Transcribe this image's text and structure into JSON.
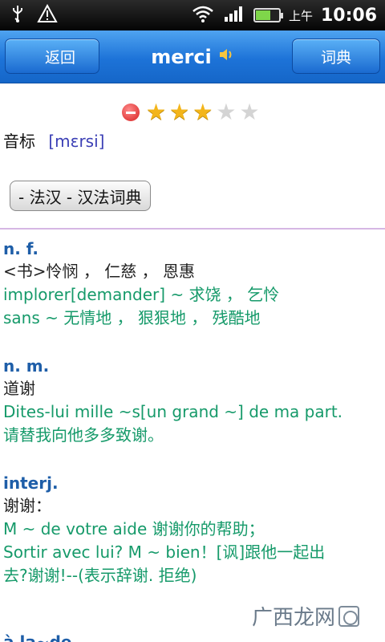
{
  "status_bar": {
    "icons": [
      "usb-icon",
      "warning-icon",
      "wifi-icon",
      "signal-icon",
      "battery-icon"
    ],
    "ampm": "上午",
    "time": "10:06"
  },
  "title_bar": {
    "back_label": "返回",
    "title": "merci",
    "dict_label": "词典",
    "accent": "#1d73d8"
  },
  "rating": {
    "value": 3,
    "max": 5
  },
  "phonetic": {
    "label": "音标",
    "ipa": "[mɛrsi]"
  },
  "dict_button": "- 法汉 - 汉法词典",
  "entries": [
    {
      "pos": "n. f.",
      "lines": [
        {
          "type": "zh",
          "text": "<书>怜悯 ， 仁慈 ， 恩惠"
        },
        {
          "type": "ex",
          "text": "implorer[demander] ~ 求饶 ， 乞怜"
        },
        {
          "type": "ex",
          "text": "sans ~ 无情地 ， 狠狠地 ， 残酷地"
        }
      ]
    },
    {
      "pos": "n. m.",
      "lines": [
        {
          "type": "zh",
          "text": "道谢"
        },
        {
          "type": "ex",
          "text": "Dites-lui mille ~s[un grand ~] de ma part."
        },
        {
          "type": "ex",
          "text": "请替我向他多多致谢。"
        }
      ]
    },
    {
      "pos": "interj.",
      "lines": [
        {
          "type": "zh",
          "text": "谢谢："
        },
        {
          "type": "ex",
          "text": "M ~ de votre aide 谢谢你的帮助；"
        },
        {
          "type": "ex",
          "text": "Sortir avec lui? M ~ bien！[讽]跟他一起出"
        },
        {
          "type": "ex",
          "text": "去?谢谢!--(表示辞谢. 拒绝)"
        }
      ]
    },
    {
      "pos": "à la~de",
      "lines": []
    }
  ],
  "watermark": "广西龙网"
}
